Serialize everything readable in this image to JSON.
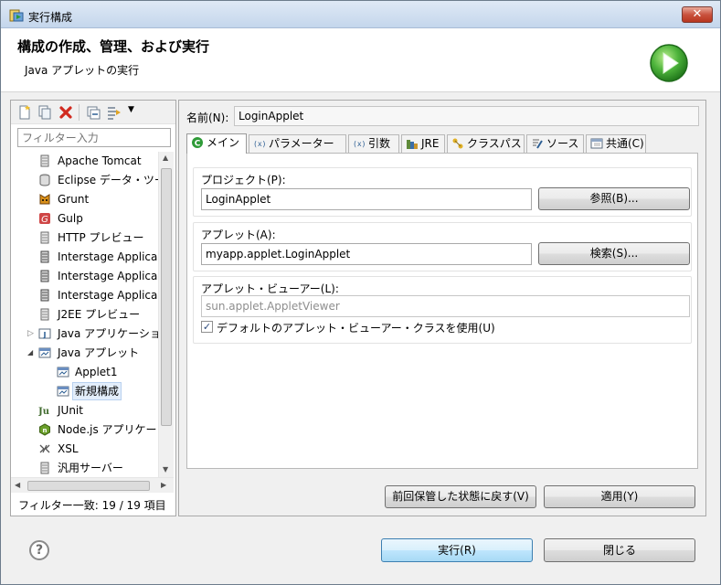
{
  "window": {
    "title": "実行構成",
    "close_glyph": "✕"
  },
  "header": {
    "title": "構成の作成、管理、および実行",
    "subtitle": "Java アプレットの実行"
  },
  "left": {
    "filter_placeholder": "フィルター入力",
    "tree": [
      {
        "label": "Apache Tomcat",
        "icon": "server-icon"
      },
      {
        "label": "Eclipse データ・ツー",
        "icon": "database-icon"
      },
      {
        "label": "Grunt",
        "icon": "grunt-icon"
      },
      {
        "label": "Gulp",
        "icon": "gulp-icon"
      },
      {
        "label": "HTTP プレビュー",
        "icon": "server-icon"
      },
      {
        "label": "Interstage Applica",
        "icon": "server-icon"
      },
      {
        "label": "Interstage Applica",
        "icon": "server-icon"
      },
      {
        "label": "Interstage Applica",
        "icon": "server-icon"
      },
      {
        "label": "J2EE プレビュー",
        "icon": "server-icon"
      },
      {
        "label": "Java アプリケーショ",
        "icon": "java-app-icon",
        "expander": "▷"
      },
      {
        "label": "Java アプレット",
        "icon": "applet-icon",
        "expander": "◢"
      },
      {
        "label": "Applet1",
        "icon": "applet-config-icon"
      },
      {
        "label": "新規構成",
        "icon": "applet-config-icon",
        "selected": true
      },
      {
        "label": "JUnit",
        "icon": "junit-icon"
      },
      {
        "label": "Node.js アプリケー",
        "icon": "nodejs-icon"
      },
      {
        "label": "XSL",
        "icon": "xsl-icon"
      },
      {
        "label": "汎用サーバー",
        "icon": "server-icon"
      }
    ],
    "filter_status": "フィルター一致: 19 / 19 項目"
  },
  "right": {
    "name_label": "名前(N):",
    "name_value": "LoginApplet",
    "tabs": [
      {
        "label": "メイン",
        "icon": "main-tab-icon",
        "active": true
      },
      {
        "label": "パラメーター",
        "icon": "parameters-tab-icon"
      },
      {
        "label": "引数",
        "icon": "arguments-tab-icon"
      },
      {
        "label": "JRE",
        "icon": "jre-tab-icon"
      },
      {
        "label": "クラスパス",
        "icon": "classpath-tab-icon"
      },
      {
        "label": "ソース",
        "icon": "source-tab-icon"
      },
      {
        "label": "共通(C)",
        "icon": "common-tab-icon"
      }
    ],
    "project": {
      "label": "プロジェクト(P):",
      "value": "LoginApplet",
      "button": "参照(B)..."
    },
    "applet": {
      "label": "アプレット(A):",
      "value": "myapp.applet.LoginApplet",
      "button": "検索(S)..."
    },
    "viewer": {
      "label": "アプレット・ビューアー(L):",
      "value": "sun.applet.AppletViewer",
      "checkbox_label": "デフォルトのアプレット・ビューアー・クラスを使用(U)",
      "checked": true
    },
    "revert_button": "前回保管した状態に戻す(V)",
    "apply_button": "適用(Y)"
  },
  "footer": {
    "run_button": "実行(R)",
    "close_button": "閉じる",
    "help_glyph": "?"
  }
}
